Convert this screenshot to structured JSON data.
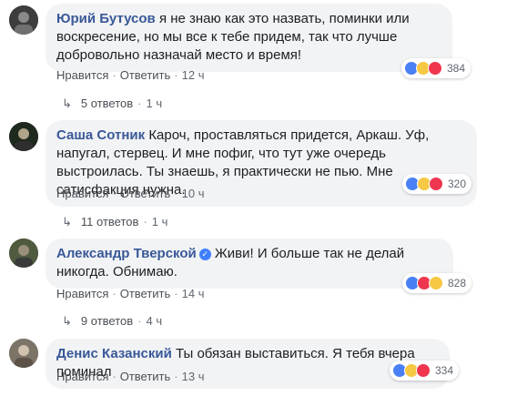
{
  "labels": {
    "like": "Нравится",
    "reply": "Ответить",
    "sep": "·"
  },
  "comments": [
    {
      "author": "Юрий Бутусов",
      "text": "я не знаю как это назвать, поминки или воскресение, но мы все к тебе придем, так что лучше добровольно назначай место и время!",
      "time": "12 ч",
      "reactions": "384",
      "replies": {
        "count_text": "5 ответов",
        "time": "1 ч"
      }
    },
    {
      "author": "Саша Сотник",
      "text": "Кароч, проставляться придется, Аркаш. Уф, напугал, стервец. И мне пофиг, что тут уже очередь выстроилась. Ты знаешь, я практически не пью. Мне сатисфакция нужна.",
      "time": "10 ч",
      "reactions": "320",
      "replies": {
        "count_text": "11 ответов",
        "time": "1 ч"
      }
    },
    {
      "author": "Александр Тверской",
      "verified": true,
      "text": "Живи! И больше так не делай никогда. Обнимаю.",
      "time": "14 ч",
      "reactions": "828",
      "replies": {
        "count_text": "9 ответов",
        "time": "4 ч"
      }
    },
    {
      "author": "Денис Казанский",
      "text": "Ты обязан выставиться. Я тебя вчера поминал",
      "time": "13 ч",
      "reactions": "334"
    }
  ],
  "colors": {
    "author": "#385898",
    "bubble": "#f2f3f5",
    "like": "#4a80f5",
    "haha": "#f7c843",
    "love": "#f0364f"
  },
  "icons": {
    "reply_arrow": "reply-arrow-icon",
    "like": "like-reaction-icon",
    "haha": "haha-reaction-icon",
    "love": "love-reaction-icon",
    "verified": "verified-badge-icon"
  }
}
